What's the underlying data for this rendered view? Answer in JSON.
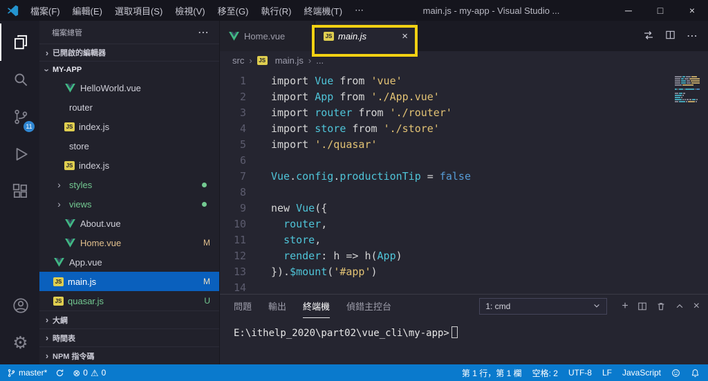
{
  "colors": {
    "accent": "#0a7acd",
    "selection_blue": "#0a60bd",
    "annotation_yellow": "#f2d113",
    "vue_green": "#41b883",
    "js_yellow": "#dfce4f",
    "git_modified": "#e2c08d",
    "git_untracked": "#73c991",
    "string": "#e2c274",
    "identifier": "#4fc4d8",
    "boolean": "#569cd6"
  },
  "icons": {
    "more": "⋯",
    "chevron_right": "›",
    "close": "×",
    "plus": "+",
    "error": "⊗",
    "warning": "⚠",
    "gear": "⚙"
  },
  "titlebar": {
    "menus": [
      {
        "name": "file",
        "label": "檔案(F)"
      },
      {
        "name": "edit",
        "label": "編輯(E)"
      },
      {
        "name": "selection",
        "label": "選取項目(S)"
      },
      {
        "name": "view",
        "label": "檢視(V)"
      },
      {
        "name": "go",
        "label": "移至(G)"
      },
      {
        "name": "run",
        "label": "執行(R)"
      },
      {
        "name": "terminal",
        "label": "終端機(T)"
      },
      {
        "name": "more",
        "label": "⋯"
      }
    ],
    "title": "main.js - my-app - Visual Studio ...",
    "controls": {
      "minimize": "─",
      "maximize": "□",
      "close": "×"
    }
  },
  "activity_bar": {
    "top": [
      {
        "name": "explorer",
        "active": true
      },
      {
        "name": "search",
        "active": false
      },
      {
        "name": "source-control",
        "active": false,
        "badge": "11"
      },
      {
        "name": "run-debug",
        "active": false
      },
      {
        "name": "extensions",
        "active": false
      }
    ],
    "bottom": [
      {
        "name": "account",
        "active": false
      },
      {
        "name": "settings",
        "active": false
      }
    ]
  },
  "sidebar": {
    "title": "檔案總管",
    "open_editors": "已開啟的編輯器",
    "project": "MY-APP",
    "tree": [
      {
        "label": "HelloWorld.vue",
        "icon": "vue",
        "indent": 3
      },
      {
        "label": "router",
        "icon": "none",
        "indent": 2
      },
      {
        "label": "index.js",
        "icon": "js",
        "indent": 3
      },
      {
        "label": "store",
        "icon": "none",
        "indent": 2
      },
      {
        "label": "index.js",
        "icon": "js",
        "indent": 3
      },
      {
        "label": "styles",
        "icon": "chev",
        "indent": 2,
        "dot": true,
        "color": "git_untracked"
      },
      {
        "label": "views",
        "icon": "chev",
        "indent": 2,
        "dot": true,
        "color": "git_untracked"
      },
      {
        "label": "About.vue",
        "icon": "vue",
        "indent": 3
      },
      {
        "label": "Home.vue",
        "icon": "vue",
        "indent": 3,
        "badge": "M",
        "color": "git_modified"
      },
      {
        "label": "App.vue",
        "icon": "vue",
        "indent": 2
      },
      {
        "label": "main.js",
        "icon": "js",
        "indent": 2,
        "badge": "M",
        "selected": true
      },
      {
        "label": "quasar.js",
        "icon": "js",
        "indent": 2,
        "badge": "U",
        "color": "git_untracked"
      }
    ],
    "bottom_sections": [
      {
        "name": "outline",
        "label": "大綱"
      },
      {
        "name": "timeline",
        "label": "時間表"
      },
      {
        "name": "npm-scripts",
        "label": "NPM 指令碼"
      }
    ]
  },
  "editor": {
    "tabs": [
      {
        "label": "Home.vue",
        "icon": "vue",
        "active": false,
        "italic": false
      },
      {
        "label": "main.js",
        "icon": "js",
        "active": true,
        "italic": true,
        "close": "×"
      }
    ],
    "breadcrumbs": [
      {
        "label": "src"
      },
      {
        "label": "main.js",
        "icon": "js"
      },
      {
        "label": "..."
      }
    ],
    "code": [
      {
        "n": 1,
        "t": [
          [
            "kw",
            "import "
          ],
          [
            "id",
            "Vue"
          ],
          [
            "kw",
            " from "
          ],
          [
            "str",
            "'vue'"
          ]
        ]
      },
      {
        "n": 2,
        "t": [
          [
            "kw",
            "import "
          ],
          [
            "id",
            "App"
          ],
          [
            "kw",
            " from "
          ],
          [
            "str",
            "'./App.vue'"
          ]
        ]
      },
      {
        "n": 3,
        "t": [
          [
            "kw",
            "import "
          ],
          [
            "id",
            "router"
          ],
          [
            "kw",
            " from "
          ],
          [
            "str",
            "'./router'"
          ]
        ]
      },
      {
        "n": 4,
        "t": [
          [
            "kw",
            "import "
          ],
          [
            "id",
            "store"
          ],
          [
            "kw",
            " from "
          ],
          [
            "str",
            "'./store'"
          ]
        ]
      },
      {
        "n": 5,
        "t": [
          [
            "kw",
            "import "
          ],
          [
            "str",
            "'./quasar'"
          ]
        ]
      },
      {
        "n": 6,
        "t": []
      },
      {
        "n": 7,
        "t": [
          [
            "id",
            "Vue"
          ],
          [
            "pn",
            "."
          ],
          [
            "id",
            "config"
          ],
          [
            "pn",
            "."
          ],
          [
            "id",
            "productionTip"
          ],
          [
            "pn",
            " = "
          ],
          [
            "bool",
            "false"
          ]
        ]
      },
      {
        "n": 8,
        "t": []
      },
      {
        "n": 9,
        "t": [
          [
            "kw",
            "new "
          ],
          [
            "id",
            "Vue"
          ],
          [
            "pn",
            "({"
          ]
        ]
      },
      {
        "n": 10,
        "t": [
          [
            "pn",
            "  "
          ],
          [
            "id",
            "router"
          ],
          [
            "pn",
            ","
          ]
        ]
      },
      {
        "n": 11,
        "t": [
          [
            "pn",
            "  "
          ],
          [
            "id",
            "store"
          ],
          [
            "pn",
            ","
          ]
        ]
      },
      {
        "n": 12,
        "t": [
          [
            "pn",
            "  "
          ],
          [
            "id",
            "render"
          ],
          [
            "pn",
            ": "
          ],
          [
            "pn",
            "h"
          ],
          [
            "pn",
            " => "
          ],
          [
            "pn",
            "h("
          ],
          [
            "id",
            "App"
          ],
          [
            "pn",
            ")"
          ]
        ]
      },
      {
        "n": 13,
        "t": [
          [
            "pn",
            "})."
          ],
          [
            "id",
            "$mount"
          ],
          [
            "pn",
            "("
          ],
          [
            "str",
            "'#app'"
          ],
          [
            "pn",
            ")"
          ]
        ]
      },
      {
        "n": 14,
        "t": []
      }
    ]
  },
  "panel": {
    "tabs": [
      {
        "name": "problems",
        "label": "問題",
        "active": false
      },
      {
        "name": "output",
        "label": "輸出",
        "active": false
      },
      {
        "name": "terminal",
        "label": "終端機",
        "active": true
      },
      {
        "name": "debug-console",
        "label": "偵錯主控台",
        "active": false
      }
    ],
    "dropdown_value": "1: cmd",
    "terminal_prompt": "E:\\ithelp_2020\\part02\\vue_cli\\my-app>"
  },
  "statusbar": {
    "branch": "master*",
    "errors": "0",
    "warnings": "0",
    "line_col": "第 1 行，第 1 欄",
    "indent": "空格: 2",
    "encoding": "UTF-8",
    "eol": "LF",
    "language": "JavaScript"
  }
}
